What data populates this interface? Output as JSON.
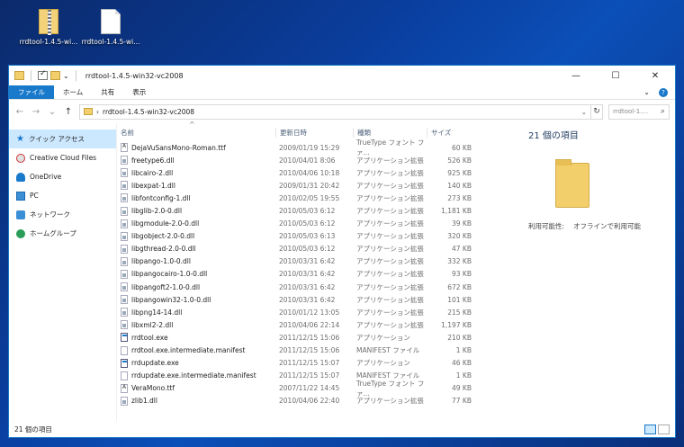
{
  "desktop": {
    "icons": [
      {
        "label": "rrdtool-1.4.5-wi...",
        "icon": "zip-folder-icon"
      },
      {
        "label": "rrdtool-1.4.5-wi...",
        "icon": "blank-file-icon"
      }
    ]
  },
  "window": {
    "title": "rrdtool-1.4.5-win32-vc2008",
    "controls": {
      "minimize": "—",
      "maximize": "☐",
      "close": "✕"
    }
  },
  "ribbon": {
    "tabs": [
      "ファイル",
      "ホーム",
      "共有",
      "表示"
    ],
    "expand_glyph": "⌄",
    "help_glyph": "?"
  },
  "address": {
    "back": "←",
    "forward": "→",
    "recent": "⌄",
    "up": "↑",
    "crumb_arrow": "›",
    "path": "rrdtool-1.4.5-win32-vc2008",
    "dropdown": "⌄",
    "refresh": "↻",
    "search_placeholder": "rrdtool-1....",
    "search_glyph": "⌕"
  },
  "nav": {
    "items": [
      {
        "label": "クイック アクセス",
        "icon": "quick-access-star-icon"
      },
      {
        "label": "Creative Cloud Files",
        "icon": "creative-cloud-icon"
      },
      {
        "label": "OneDrive",
        "icon": "onedrive-icon"
      },
      {
        "label": "PC",
        "icon": "pc-icon"
      },
      {
        "label": "ネットワーク",
        "icon": "network-icon"
      },
      {
        "label": "ホームグループ",
        "icon": "homegroup-icon"
      }
    ],
    "star_glyph": "★"
  },
  "columns": {
    "name": "名前",
    "date": "更新日時",
    "type": "種類",
    "size": "サイズ",
    "sort_glyph": "^"
  },
  "files": [
    {
      "name": "DejaVuSansMono-Roman.ttf",
      "date": "2009/01/19 15:29",
      "type": "TrueType フォント ファ...",
      "size": "60 KB",
      "kind": "ttf"
    },
    {
      "name": "freetype6.dll",
      "date": "2010/04/01 8:06",
      "type": "アプリケーション拡張",
      "size": "526 KB",
      "kind": "dll"
    },
    {
      "name": "libcairo-2.dll",
      "date": "2010/04/06 10:18",
      "type": "アプリケーション拡張",
      "size": "925 KB",
      "kind": "dll"
    },
    {
      "name": "libexpat-1.dll",
      "date": "2009/01/31 20:42",
      "type": "アプリケーション拡張",
      "size": "140 KB",
      "kind": "dll"
    },
    {
      "name": "libfontconfig-1.dll",
      "date": "2010/02/05 19:55",
      "type": "アプリケーション拡張",
      "size": "273 KB",
      "kind": "dll"
    },
    {
      "name": "libglib-2.0-0.dll",
      "date": "2010/05/03 6:12",
      "type": "アプリケーション拡張",
      "size": "1,181 KB",
      "kind": "dll"
    },
    {
      "name": "libgmodule-2.0-0.dll",
      "date": "2010/05/03 6:12",
      "type": "アプリケーション拡張",
      "size": "39 KB",
      "kind": "dll"
    },
    {
      "name": "libgobject-2.0-0.dll",
      "date": "2010/05/03 6:13",
      "type": "アプリケーション拡張",
      "size": "320 KB",
      "kind": "dll"
    },
    {
      "name": "libgthread-2.0-0.dll",
      "date": "2010/05/03 6:12",
      "type": "アプリケーション拡張",
      "size": "47 KB",
      "kind": "dll"
    },
    {
      "name": "libpango-1.0-0.dll",
      "date": "2010/03/31 6:42",
      "type": "アプリケーション拡張",
      "size": "332 KB",
      "kind": "dll"
    },
    {
      "name": "libpangocairo-1.0-0.dll",
      "date": "2010/03/31 6:42",
      "type": "アプリケーション拡張",
      "size": "93 KB",
      "kind": "dll"
    },
    {
      "name": "libpangoft2-1.0-0.dll",
      "date": "2010/03/31 6:42",
      "type": "アプリケーション拡張",
      "size": "672 KB",
      "kind": "dll"
    },
    {
      "name": "libpangowin32-1.0-0.dll",
      "date": "2010/03/31 6:42",
      "type": "アプリケーション拡張",
      "size": "101 KB",
      "kind": "dll"
    },
    {
      "name": "libpng14-14.dll",
      "date": "2010/01/12 13:05",
      "type": "アプリケーション拡張",
      "size": "215 KB",
      "kind": "dll"
    },
    {
      "name": "libxml2-2.dll",
      "date": "2010/04/06 22:14",
      "type": "アプリケーション拡張",
      "size": "1,197 KB",
      "kind": "dll"
    },
    {
      "name": "rrdtool.exe",
      "date": "2011/12/15 15:06",
      "type": "アプリケーション",
      "size": "210 KB",
      "kind": "exe"
    },
    {
      "name": "rrdtool.exe.intermediate.manifest",
      "date": "2011/12/15 15:06",
      "type": "MANIFEST ファイル",
      "size": "1 KB",
      "kind": "file"
    },
    {
      "name": "rrdupdate.exe",
      "date": "2011/12/15 15:07",
      "type": "アプリケーション",
      "size": "46 KB",
      "kind": "exe"
    },
    {
      "name": "rrdupdate.exe.intermediate.manifest",
      "date": "2011/12/15 15:07",
      "type": "MANIFEST ファイル",
      "size": "1 KB",
      "kind": "file"
    },
    {
      "name": "VeraMono.ttf",
      "date": "2007/11/22 14:45",
      "type": "TrueType フォント ファ...",
      "size": "49 KB",
      "kind": "ttf"
    },
    {
      "name": "zlib1.dll",
      "date": "2010/04/06 22:40",
      "type": "アプリケーション拡張",
      "size": "77 KB",
      "kind": "dll"
    }
  ],
  "preview": {
    "count": "21 個の項目",
    "availability_label": "利用可能性:",
    "availability_value": "オフラインで利用可能"
  },
  "status": {
    "count": "21 個の項目"
  }
}
